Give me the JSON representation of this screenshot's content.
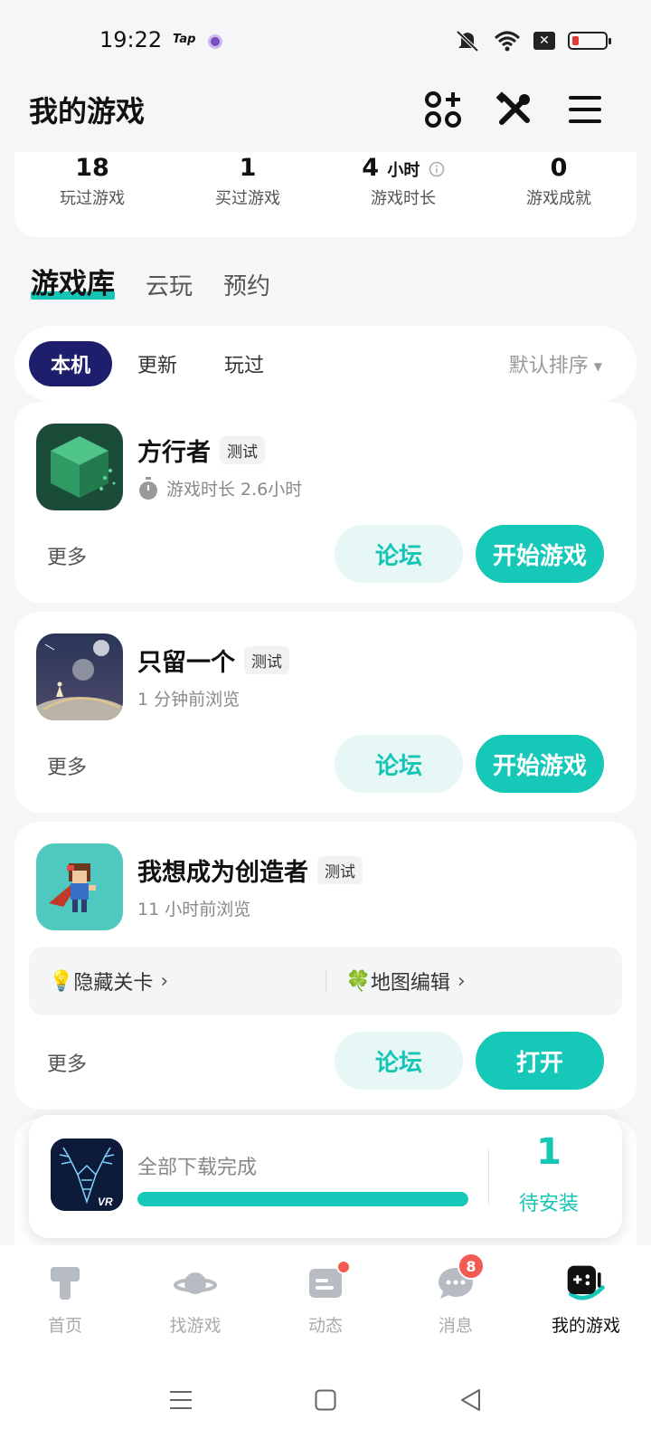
{
  "status_bar": {
    "time": "19:22",
    "app_label": "Tap"
  },
  "header": {
    "title": "我的游戏"
  },
  "stats": [
    {
      "value": "18",
      "unit": "",
      "label": "玩过游戏"
    },
    {
      "value": "1",
      "unit": "",
      "label": "买过游戏"
    },
    {
      "value": "4",
      "unit": "小时",
      "label": "游戏时长"
    },
    {
      "value": "0",
      "unit": "",
      "label": "游戏成就"
    }
  ],
  "main_tabs": [
    "游戏库",
    "云玩",
    "预约"
  ],
  "filters": {
    "chips": [
      "本机",
      "更新",
      "玩过"
    ],
    "sort_label": "默认排序"
  },
  "games": [
    {
      "name": "方行者",
      "tag": "测试",
      "subtitle": "游戏时长 2.6小时",
      "more": "更多",
      "forum": "论坛",
      "action": "开始游戏"
    },
    {
      "name": "只留一个",
      "tag": "测试",
      "subtitle": "1 分钟前浏览",
      "more": "更多",
      "forum": "论坛",
      "action": "开始游戏"
    },
    {
      "name": "我想成为创造者",
      "tag": "测试",
      "subtitle": "11 小时前浏览",
      "more": "更多",
      "forum": "论坛",
      "action": "打开",
      "extras": [
        {
          "label": "隐藏关卡",
          "emoji": "💡"
        },
        {
          "label": "地图编辑",
          "emoji": "🍀"
        }
      ]
    }
  ],
  "download": {
    "status": "全部下载完成",
    "count": "1",
    "pending_label": "待安装",
    "progress": 1.0
  },
  "bottom_nav": [
    {
      "label": "首页",
      "icon": "home-t-icon"
    },
    {
      "label": "找游戏",
      "icon": "planet-icon"
    },
    {
      "label": "动态",
      "icon": "feed-icon"
    },
    {
      "label": "消息",
      "icon": "chat-icon",
      "badge": "8"
    },
    {
      "label": "我的游戏",
      "icon": "gamepad-icon",
      "active": true
    }
  ],
  "colors": {
    "accent": "#15c8b8",
    "chip_active": "#1d1f6d",
    "badge": "#f45a54"
  }
}
